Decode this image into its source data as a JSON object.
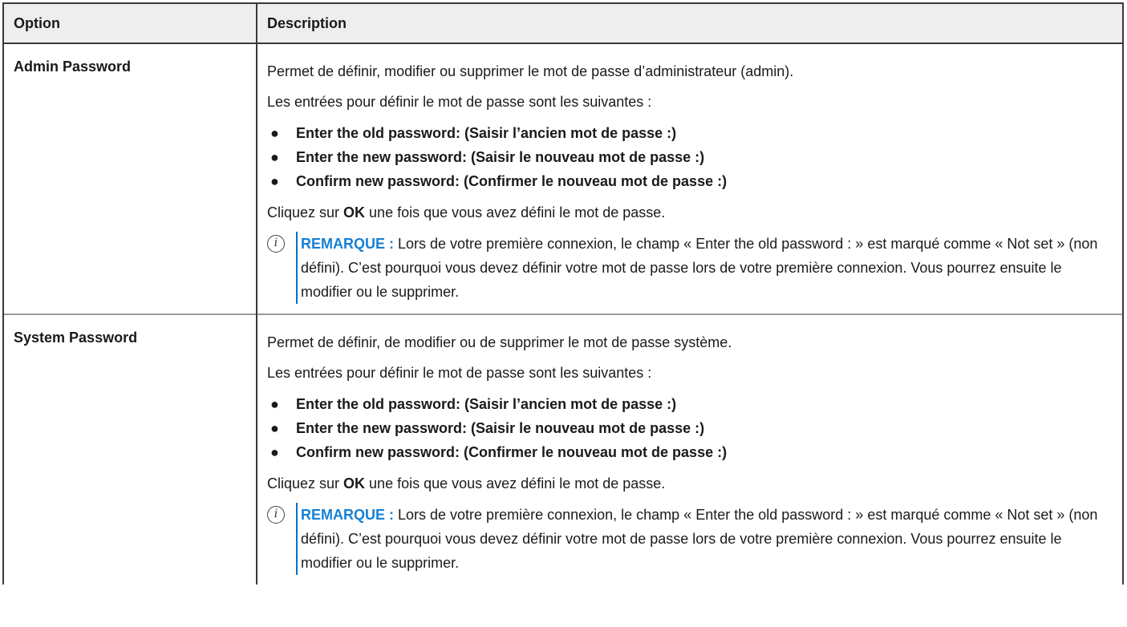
{
  "table": {
    "header": {
      "option": "Option",
      "description": "Description"
    },
    "rows": [
      {
        "option": "Admin Password",
        "intro": "Permet de définir, modifier ou supprimer le mot de passe d’administrateur (admin).",
        "entries_intro": "Les entrées pour définir le mot de passe sont les suivantes :",
        "entries": [
          "Enter the old password: (Saisir l’ancien mot de passe :)",
          "Enter the new password: (Saisir le nouveau mot de passe :)",
          "Confirm new password: (Confirmer le nouveau mot de passe :)"
        ],
        "ok_prefix": "Cliquez sur ",
        "ok_label": "OK",
        "ok_suffix": " une fois que vous avez défini le mot de passe.",
        "note_label": "REMARQUE :",
        "note_text": " Lors de votre première connexion, le champ « Enter the old password : » est marqué comme « Not set » (non défini). C’est pourquoi vous devez définir votre mot de passe lors de votre première connexion. Vous pourrez ensuite le modifier ou le supprimer."
      },
      {
        "option": "System Password",
        "intro": "Permet de définir, de modifier ou de supprimer le mot de passe système.",
        "entries_intro": "Les entrées pour définir le mot de passe sont les suivantes :",
        "entries": [
          "Enter the old password: (Saisir l’ancien mot de passe :)",
          "Enter the new password: (Saisir le nouveau mot de passe :)",
          "Confirm new password: (Confirmer le nouveau mot de passe :)"
        ],
        "ok_prefix": "Cliquez sur ",
        "ok_label": "OK",
        "ok_suffix": " une fois que vous avez défini le mot de passe.",
        "note_label": "REMARQUE :",
        "note_text": " Lors de votre première connexion, le champ « Enter the old password : » est marqué comme « Not set » (non défini). C’est pourquoi vous devez définir votre mot de passe lors de votre première connexion. Vous pourrez ensuite le modifier ou le supprimer."
      }
    ]
  },
  "icons": {
    "note_icon": "info-icon",
    "bullet_glyph": "●"
  },
  "colors": {
    "note_label": "#1680d5",
    "note_bar": "#0a6fc2",
    "header_bg": "#eeeeee"
  }
}
